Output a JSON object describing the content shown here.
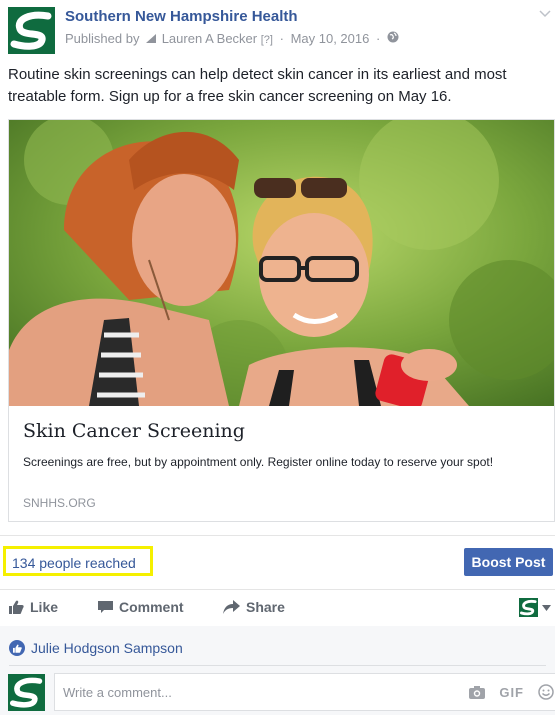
{
  "header": {
    "page_name": "Southern New Hampshire Health",
    "published_by_label": "Published by",
    "author": "Lauren A Becker",
    "author_suffix": "[?]",
    "date": "May 10, 2016"
  },
  "post": {
    "text": "Routine skin screenings can help detect skin cancer in its earliest and most treatable form. Sign up for a free skin cancer screening on May 16."
  },
  "link_card": {
    "title": "Skin Cancer Screening",
    "description": "Screenings are free, but by appointment only. Register online today to reserve your spot!",
    "domain": "SNHHS.ORG"
  },
  "insights": {
    "reach_text": "134 people reached",
    "boost_label": "Boost Post",
    "highlight_color": "#f5f000"
  },
  "actions": {
    "like_label": "Like",
    "comment_label": "Comment",
    "share_label": "Share"
  },
  "reactions": {
    "liker_name": "Julie Hodgson Sampson"
  },
  "comment_input": {
    "placeholder": "Write a comment...",
    "gif_label": "GIF"
  },
  "colors": {
    "link_blue": "#365899",
    "button_blue": "#4267b2",
    "brand_green": "#0f6b3f"
  }
}
